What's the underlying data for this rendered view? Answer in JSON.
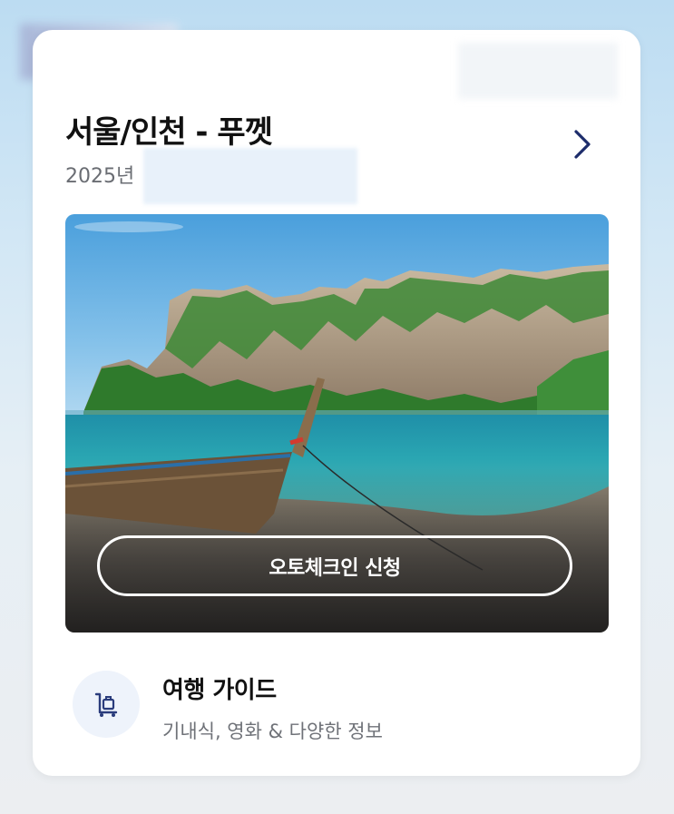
{
  "trip": {
    "route_title": "서울/인천 - 푸껫",
    "date_prefix": "2025년"
  },
  "hero": {
    "image_description_icon": "tropical-beach-longtail-boat-image",
    "checkin_button_label": "오토체크인 신청"
  },
  "guide": {
    "title": "여행 가이드",
    "subtitle": "기내식, 영화 & 다양한 정보",
    "icon": "luggage-cart-icon"
  },
  "colors": {
    "chevron": "#1d2c6b",
    "icon_tint": "#2a3c7c",
    "icon_bg": "#eef3fb"
  }
}
